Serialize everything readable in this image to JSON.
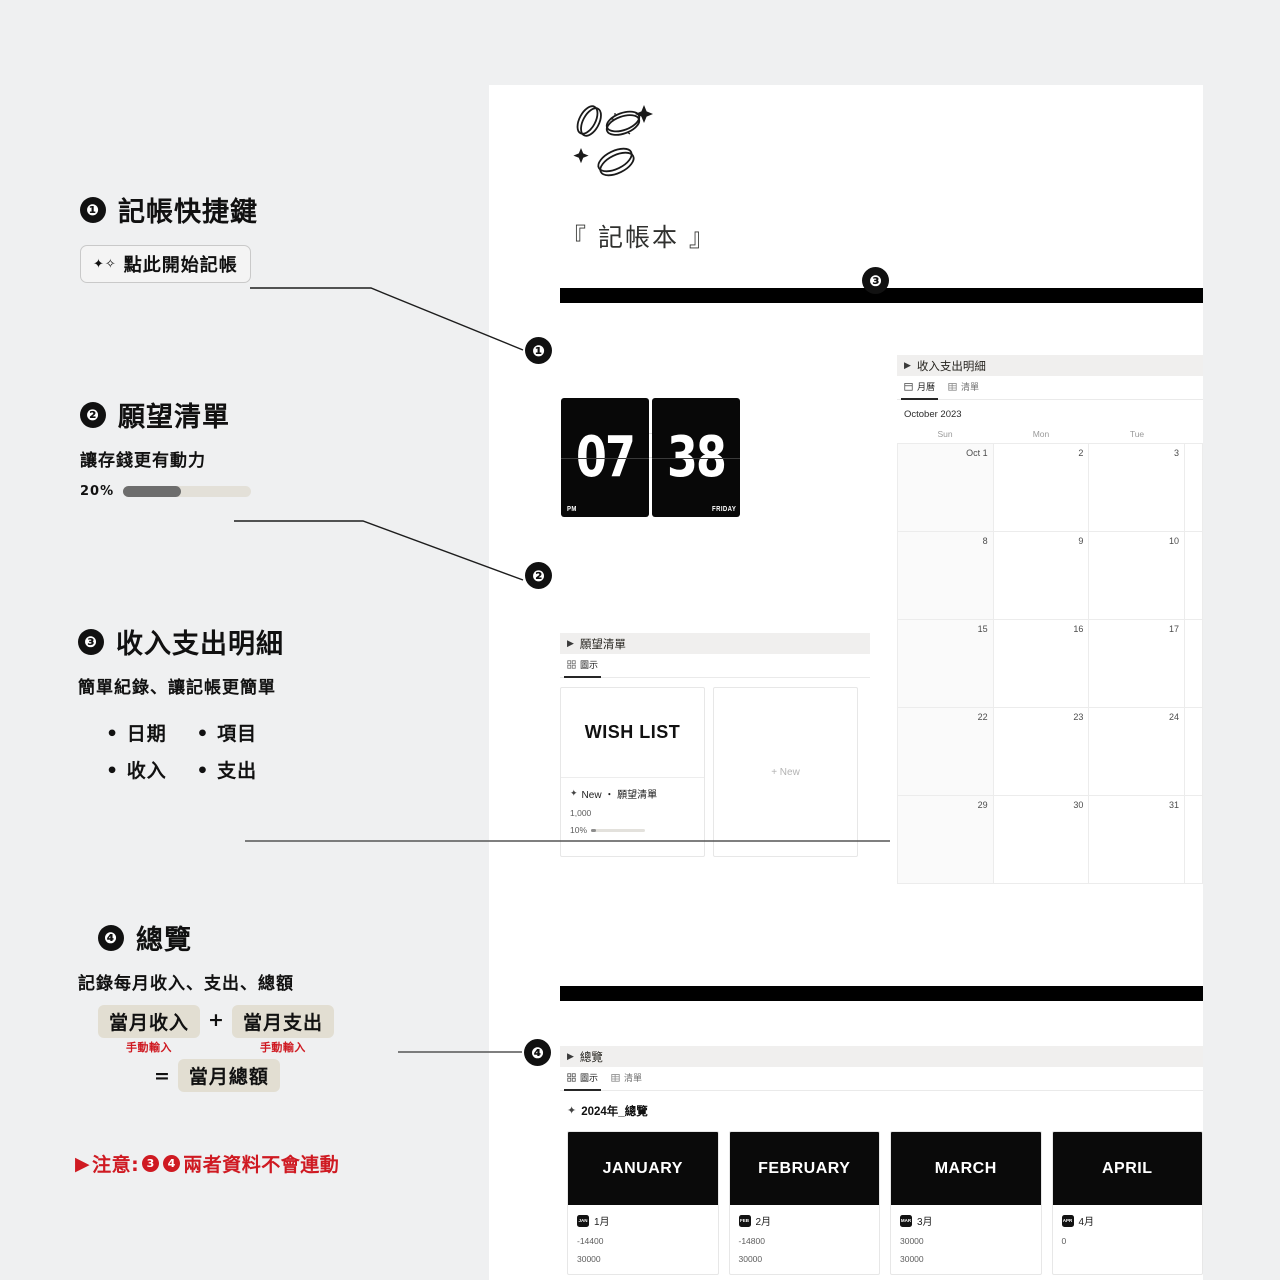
{
  "annotations": [
    {
      "number": "❶",
      "title": "記帳快捷鍵",
      "pill": "點此開始記帳"
    },
    {
      "number": "❷",
      "title": "願望清單",
      "subtitle": "讓存錢更有動力",
      "progress_label": "20%",
      "progress_value": 20
    },
    {
      "number": "❸",
      "title": "收入支出明細",
      "subtitle": "簡單紀錄、讓記帳更簡單",
      "bullets": [
        "日期",
        "項目",
        "收入",
        "支出"
      ]
    },
    {
      "number": "❹",
      "title": "總覽",
      "subtitle": "記錄每月收入、支出、總額",
      "formula": {
        "term1": "當月收入",
        "term1_note": "手動輸入",
        "op1": "+",
        "term2": "當月支出",
        "term2_note": "手動輸入",
        "op2": "=",
        "result": "當月總額"
      }
    }
  ],
  "warning": {
    "arrow": "▶",
    "prefix": "注意:",
    "badge_a": "3",
    "badge_b": "4",
    "text": "兩者資料不會連動"
  },
  "app": {
    "title": "『 記帳本 』",
    "cover_icon": "coins-sparkle-illustration",
    "start_button": {
      "icon": "sparkles-icon",
      "label": "點此開始記帳"
    },
    "clock": {
      "hour": "07",
      "minute": "38",
      "meridiem": "PM",
      "weekday": "FRIDAY"
    },
    "wishlist": {
      "block_title": "願望清單",
      "tabs": [
        {
          "label": "圖示",
          "icon": "gallery-icon",
          "active": true
        }
      ],
      "cards": [
        {
          "cover_text": "WISH LIST",
          "title": "New ・ 願望清單",
          "amount": "1,000",
          "progress_label": "10%",
          "progress_value": 10
        }
      ],
      "new_card_label": "+ New"
    },
    "ledger": {
      "block_title": "收入支出明細",
      "tabs": [
        {
          "label": "月曆",
          "icon": "calendar-icon",
          "active": true
        },
        {
          "label": "清單",
          "icon": "table-icon",
          "active": false
        }
      ],
      "month_label": "October 2023",
      "weekdays": [
        "Sun",
        "Mon",
        "Tue"
      ],
      "weeks": [
        [
          "Oct 1",
          "2",
          "3"
        ],
        [
          "8",
          "9",
          "10"
        ],
        [
          "15",
          "16",
          "17"
        ],
        [
          "22",
          "23",
          "24"
        ],
        [
          "29",
          "30",
          "31"
        ]
      ]
    },
    "overview": {
      "block_title": "總覽",
      "tabs": [
        {
          "label": "圖示",
          "icon": "gallery-icon",
          "active": true
        },
        {
          "label": "清單",
          "icon": "table-icon",
          "active": false
        }
      ],
      "heading_icon": "sparkles-icon",
      "heading": "2024年_總覽",
      "months": [
        {
          "cover": "JANUARY",
          "badge": "JAN",
          "name": "1月",
          "value1": "-14400",
          "value2": "30000"
        },
        {
          "cover": "FEBRUARY",
          "badge": "FEB",
          "name": "2月",
          "value1": "-14800",
          "value2": "30000"
        },
        {
          "cover": "MARCH",
          "badge": "MAR",
          "name": "3月",
          "value1": "30000",
          "value2": "30000"
        },
        {
          "cover": "APRIL",
          "badge": "APR",
          "name": "4月",
          "value1": "0",
          "value2": ""
        }
      ]
    }
  },
  "callout_badges": {
    "one": "❶",
    "two": "❷",
    "three": "❸",
    "four": "❹"
  },
  "colors": {
    "background": "#eff0f1",
    "page": "#ffffff",
    "ink": "#111111",
    "accent_red": "#cf1a22",
    "tag_beige": "#e2ded2"
  }
}
